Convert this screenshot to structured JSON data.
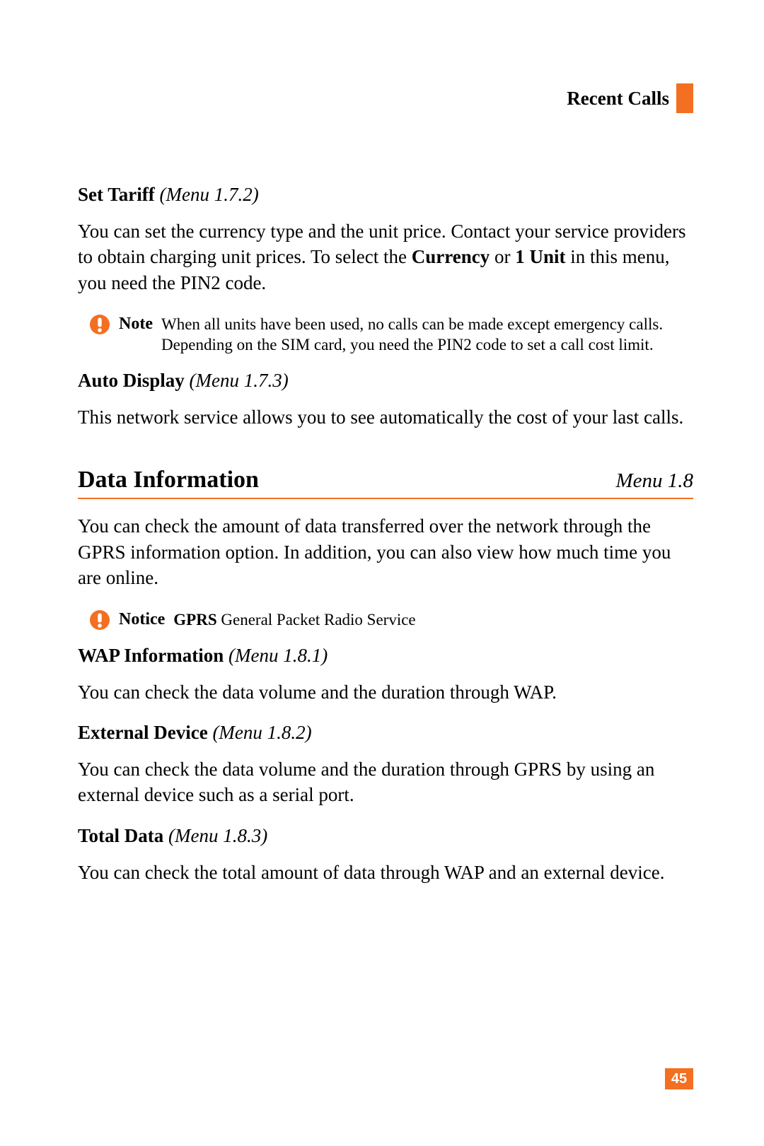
{
  "header": {
    "title": "Recent Calls"
  },
  "sections": {
    "set_tariff": {
      "title": "Set Tariff",
      "menu": "(Menu 1.7.2)",
      "body_pre": "You can set the currency type and the unit price. Contact your service providers to obtain charging unit prices. To select the ",
      "bold1": "Currency",
      "mid": " or ",
      "bold2": "1 Unit",
      "body_post": " in this menu, you need the PIN2 code."
    },
    "note1": {
      "label": "Note",
      "body": "When all units have been used, no calls can be made except emergency calls. Depending on the SIM card, you need the PIN2 code to set a call cost limit."
    },
    "auto_display": {
      "title": "Auto Display",
      "menu": "(Menu 1.7.3)",
      "body": "This network service allows you to see automatically the cost of your last calls."
    },
    "data_info": {
      "title": "Data Information",
      "menu": "Menu 1.8",
      "body": "You can check the amount of data transferred over the network through the GPRS information option. In addition, you can also view how much time you are online."
    },
    "notice": {
      "label": "Notice",
      "bold": "GPRS",
      "rest": " General Packet Radio Service"
    },
    "wap_info": {
      "title": "WAP Information",
      "menu": "(Menu 1.8.1)",
      "body": "You can check the data volume and the duration through WAP."
    },
    "ext_dev": {
      "title": "External Device",
      "menu": "(Menu 1.8.2)",
      "body": "You can check the data volume and the duration through GPRS by using an external device such as a serial port."
    },
    "total_data": {
      "title": "Total Data",
      "menu": "(Menu 1.8.3)",
      "body": "You can check the total amount of data through WAP and an external device."
    }
  },
  "page_number": "45"
}
